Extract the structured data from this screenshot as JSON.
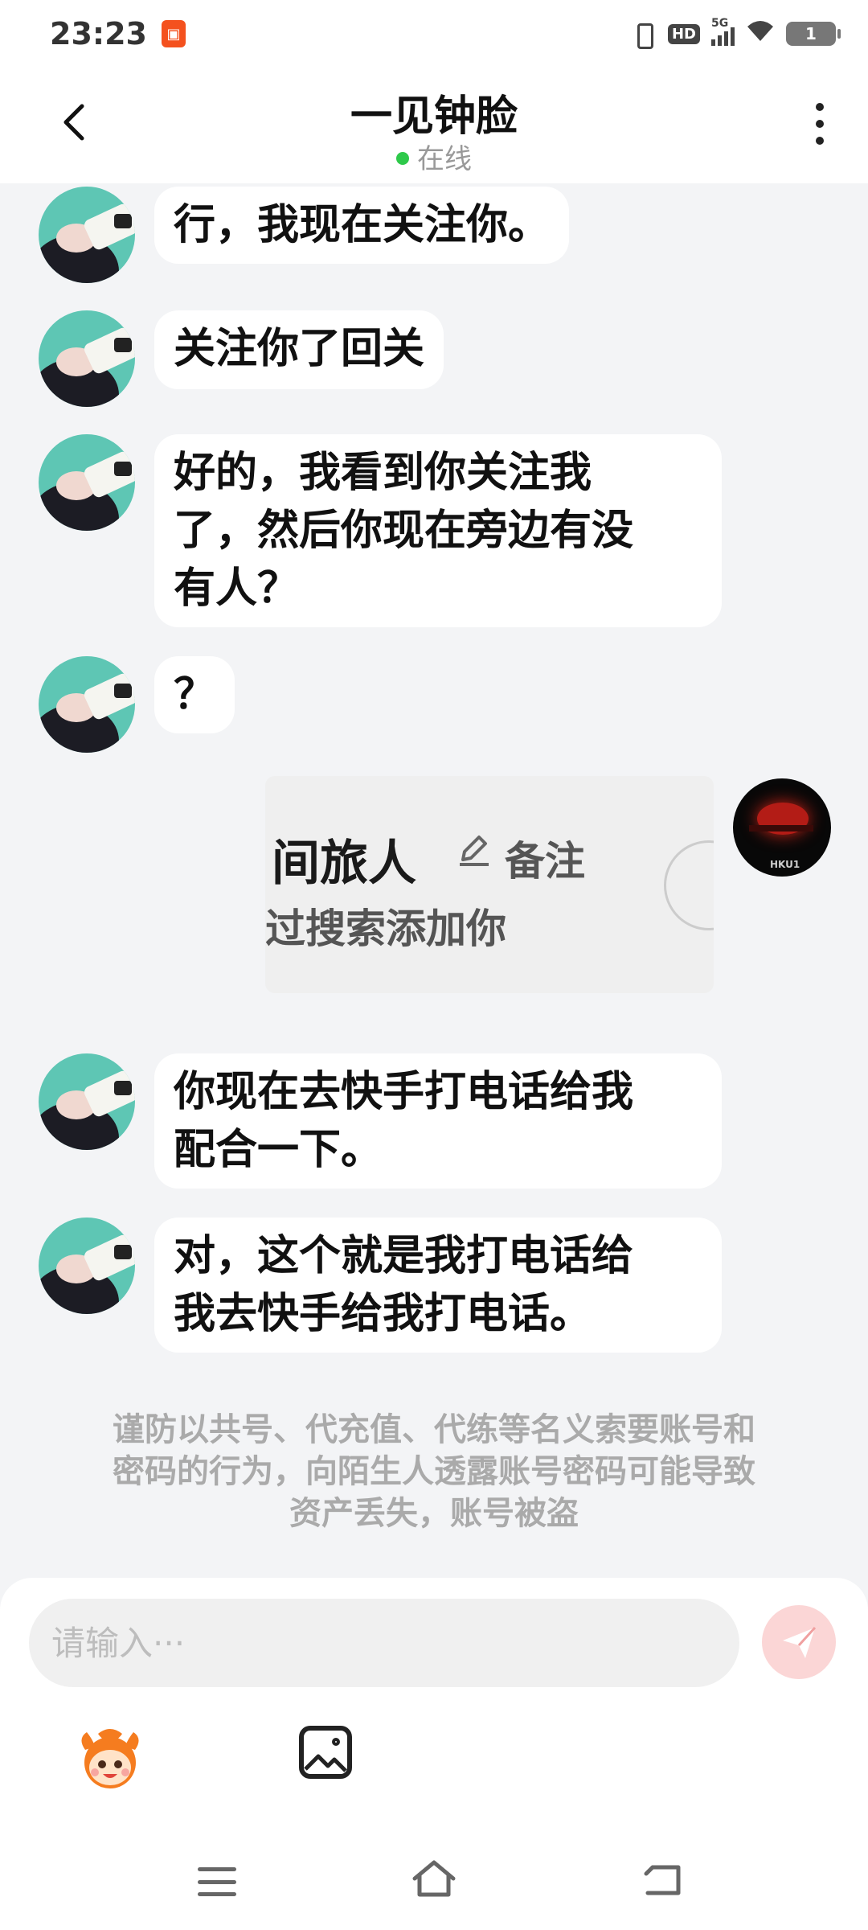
{
  "status_bar": {
    "time": "23:23",
    "network": "5G",
    "hd_label": "HD",
    "battery": "1"
  },
  "header": {
    "title": "一见钟脸",
    "status": "在线"
  },
  "messages": [
    {
      "sender": "other",
      "text": "行，我现在关注你。"
    },
    {
      "sender": "other",
      "text": "关注你了回关"
    },
    {
      "sender": "other",
      "lines": [
        "好的，我看到你关注我",
        "了，然后你现在旁边有没",
        "有人？"
      ]
    },
    {
      "sender": "other",
      "text": "？"
    },
    {
      "sender": "me",
      "type": "image",
      "image_name": "间旅人",
      "image_remark": "备注",
      "image_sub": "过搜索添加你"
    },
    {
      "sender": "other",
      "lines": [
        "你现在去快手打电话给我",
        "配合一下。"
      ]
    },
    {
      "sender": "other",
      "lines": [
        "对，这个就是我打电话给",
        "我去快手给我打电话。"
      ]
    }
  ],
  "warning": {
    "lines": [
      "谨防以共号、代充值、代练等名义索要账号和",
      "密码的行为，向陌生人透露账号密码可能导致",
      "资产丢失，账号被盗"
    ]
  },
  "input": {
    "placeholder": "请输入···"
  },
  "icons": {
    "back": "back-arrow-icon",
    "more": "more-vertical-icon",
    "send": "send-icon",
    "emoji": "emoji-mascot-icon",
    "image": "image-icon",
    "nav_menu": "menu-icon",
    "nav_home": "home-icon",
    "nav_back": "back-icon"
  },
  "colors": {
    "online": "#2ec94a",
    "send_disabled": "#fbd6d6",
    "send_icon": "#f0a0a0",
    "chat_bg": "#f3f4f6"
  }
}
